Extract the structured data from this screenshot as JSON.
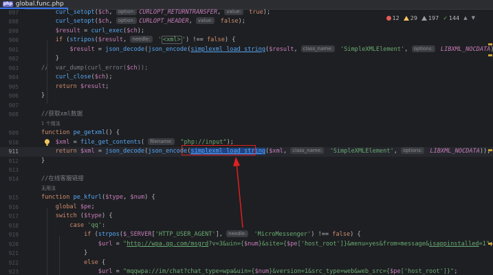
{
  "tab": {
    "icon": "php",
    "filename": "global.func.php"
  },
  "inspections": {
    "errors": "12",
    "warnings": "29",
    "weak_warnings": "197",
    "typos": "144"
  },
  "lines": [
    {
      "num": "897",
      "html": "    <span class=\"fn\">curl_setopt</span>(<span class=\"var\">$ch</span>, <span class=\"hint\">option:</span><span class=\"cst\">CURLOPT_RETURNTRANSFER</span>, <span class=\"hint\">value:</span> <span class=\"kw\">true</span>);"
    },
    {
      "num": "898",
      "html": "    <span class=\"fn\">curl_setopt</span>(<span class=\"var\">$ch</span>, <span class=\"hint\">option:</span><span class=\"cst\">CURLOPT_HEADER</span>, <span class=\"hint\">value:</span> <span class=\"kw\">false</span>);"
    },
    {
      "num": "899",
      "html": "    <span class=\"var\">$result</span> = <span class=\"fn\">curl_exec</span>(<span class=\"var\">$ch</span>);"
    },
    {
      "num": "900",
      "html": "    <span class=\"kw\">if</span> (<span class=\"fn\">stripos</span>(<span class=\"var\">$result</span>, <span class=\"hint\">needle:</span> <span class=\"str\">'<span class=\"tagbox\">&lt;xml&gt;</span>'</span>) !== <span class=\"kw\">false</span>) {"
    },
    {
      "num": "901",
      "html": "        <span class=\"var\">$result</span> = <span class=\"fn\">json_decode</span>(<span class=\"fn\">json_encode</span>(<span class=\"fn\" style=\"text-decoration:underline\">simplexml_load_string</span>(<span class=\"var\">$result</span>, <span class=\"hint\">class_name:</span> <span class=\"str\">'SimpleXMLElement'</span>, <span class=\"hint\">options:</span> <span class=\"cst\">LIBXML_NOCDATA</span>)), <span class=\"hint\">assoc</span>"
    },
    {
      "num": "902",
      "html": "    }"
    },
    {
      "num": "903",
      "html": "<span class=\"cmt\">//  var_dump(curl_error(</span><span class=\"var\">$ch</span><span class=\"cmt\">));</span>"
    },
    {
      "num": "904",
      "html": "    <span class=\"fn\">curl_close</span>(<span class=\"var\">$ch</span>);"
    },
    {
      "num": "905",
      "html": "    <span class=\"kw\">return</span> <span class=\"var\">$result</span>;"
    },
    {
      "num": "906",
      "html": "}"
    },
    {
      "num": "907",
      "html": ""
    },
    {
      "num": "908",
      "html": "<span class=\"cmt\">//获取xml数据</span>"
    },
    {
      "num": "",
      "html": "<span class=\"sub\">1 个用法</span>"
    },
    {
      "num": "909",
      "html": "<span class=\"kw\">function</span> <span class=\"fn\">pe_getxml</span>() {"
    },
    {
      "num": "910",
      "html": "    <span class=\"var\">$xml</span> = <span class=\"fn\">file_get_contents</span>( <span class=\"hint\">filename:</span> <span class=\"str\">\"php://input\"</span>);"
    },
    {
      "num": "911",
      "html": "    <span class=\"kw\">return</span> <span class=\"var\">$xml</span> = <span class=\"fn\">json_decode</span>(<span class=\"fn\">json_encode</span>(<span class=\"fn hl\" style=\"text-decoration:underline\">simplexml_load_string</span>(<span class=\"var\">$xml</span>, <span class=\"hint\">class_name:</span> <span class=\"str\">'SimpleXMLElement'</span>, <span class=\"hint\">options:</span> <span class=\"cst\">LIBXML_NOCDATA</span>)), <span class=\"hint\">assoc:</span> <span class=\"kw\">tr</span>",
      "active": true
    },
    {
      "num": "912",
      "html": "}"
    },
    {
      "num": "913",
      "html": ""
    },
    {
      "num": "914",
      "html": "<span class=\"cmt\">//在线客服链接</span>"
    },
    {
      "num": "",
      "html": "<span class=\"sub\">无用法</span>"
    },
    {
      "num": "915",
      "html": "<span class=\"kw\">function</span> <span class=\"fn\">pe_kfurl</span>(<span class=\"var\">$type</span>, <span class=\"var\">$num</span>) {"
    },
    {
      "num": "916",
      "html": "    <span class=\"kw\">global</span> <span class=\"var\">$pe</span>;"
    },
    {
      "num": "917",
      "html": "    <span class=\"kw\">switch</span> (<span class=\"var\">$type</span>) {"
    },
    {
      "num": "918",
      "html": "        <span class=\"kw\">case</span> <span class=\"str\">'qq'</span>:"
    },
    {
      "num": "919",
      "html": "            <span class=\"kw\">if</span> (<span class=\"fn\">strpos</span>(<span class=\"var\">$_SERVER</span>[<span class=\"str\">'HTTP_USER_AGENT'</span>], <span class=\"hint\">needle:</span> <span class=\"str\">'MicroMessenger'</span>) !== <span class=\"kw\">false</span>) {"
    },
    {
      "num": "920",
      "html": "                <span class=\"var\">$url</span> = <span class=\"str\">\"<u>http://wpa.qq.com/msgrd</u>?v=3&amp;uin={<span class=\"var\">$num</span>}&amp;site={<span class=\"var\">$pe</span>['host_root']}&amp;menu=yes&amp;from=message&amp;<u>isappinstalled</u>=1\"</span>;"
    },
    {
      "num": "921",
      "html": "            }"
    },
    {
      "num": "922",
      "html": "            <span class=\"kw\">else</span> {"
    },
    {
      "num": "923",
      "html": "                <span class=\"var\">$url</span> = <span class=\"str\">\"mqqwpa://im/chat?chat_type=wpa&amp;uin={<span class=\"var\">$num</span>}&amp;version=1&amp;src_type=web&amp;web_src={<span class=\"var\">$pe</span>['host_root']}\"</span>;"
    }
  ]
}
